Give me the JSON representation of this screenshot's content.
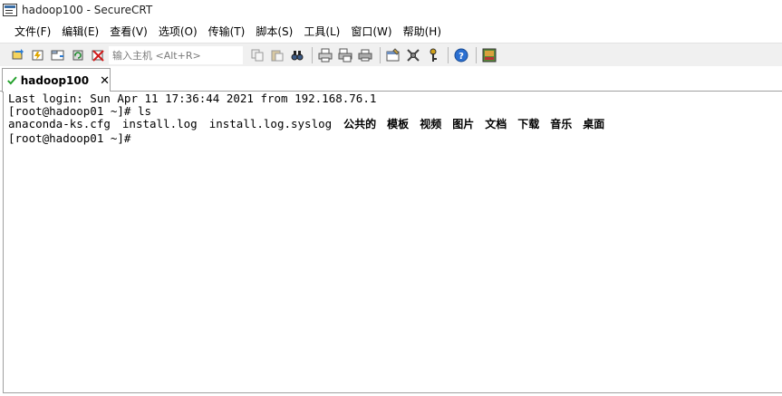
{
  "window": {
    "title": "hadoop100 - SecureCRT"
  },
  "menu": [
    {
      "label": "文件(F)"
    },
    {
      "label": "编辑(E)"
    },
    {
      "label": "查看(V)"
    },
    {
      "label": "选项(O)"
    },
    {
      "label": "传输(T)"
    },
    {
      "label": "脚本(S)"
    },
    {
      "label": "工具(L)"
    },
    {
      "label": "窗口(W)"
    },
    {
      "label": "帮助(H)"
    }
  ],
  "toolbar": {
    "quick_connect_placeholder": "输入主机 <Alt+R>",
    "icons": [
      "connect-icon",
      "quick-connect-icon",
      "connect-tab-icon",
      "reconnect-icon",
      "disconnect-icon",
      "copy-icon",
      "paste-icon",
      "find-icon",
      "print-setup-icon",
      "print-selection-icon",
      "print-icon",
      "session-options-icon",
      "global-options-icon",
      "keymap-icon",
      "help-icon",
      "sftp-icon"
    ]
  },
  "tabs": [
    {
      "label": "hadoop100",
      "close": "✕",
      "status_color": "#22a02a"
    }
  ],
  "terminal": {
    "line1": "Last login: Sun Apr 11 17:36:44 2021 from 192.168.76.1",
    "line2": "[root@hadoop01 ~]# ls",
    "files": [
      "anaconda-ks.cfg",
      "install.log",
      "install.log.syslog"
    ],
    "dirs": [
      "公共的",
      "模板",
      "视频",
      "图片",
      "文档",
      "下载",
      "音乐",
      "桌面"
    ],
    "line4": "[root@hadoop01 ~]# "
  }
}
